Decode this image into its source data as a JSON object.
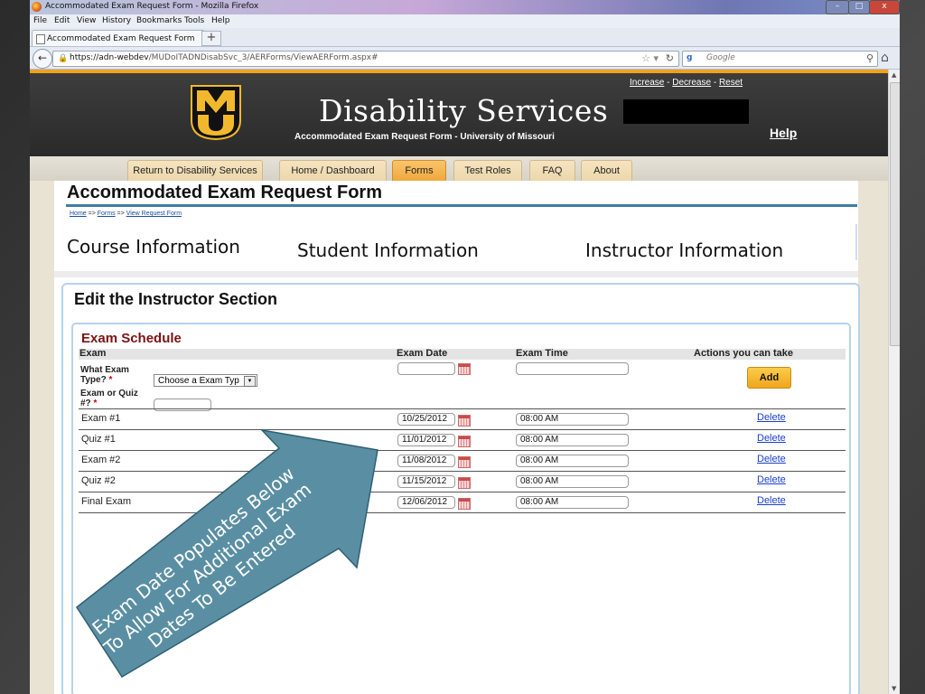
{
  "window": {
    "title": "Accommodated Exam Request Form - Mozilla Firefox",
    "minimize": "–",
    "maximize": "□",
    "close": "x"
  },
  "menu": [
    "File",
    "Edit",
    "View",
    "History",
    "Bookmarks",
    "Tools",
    "Help"
  ],
  "tab": {
    "label": "Accommodated Exam Request Form",
    "new_tab": "+"
  },
  "nav": {
    "url_host": "https://adn-webdev",
    "url_path": "/MUDoITADNDisabSvc_3/AERForms/ViewAERForm.aspx#",
    "search_engine": "g",
    "search_placeholder": "Google"
  },
  "header": {
    "logo_text": "MU",
    "title": "Disability Services",
    "subtitle": "Accommodated Exam Request Form - University of Missouri",
    "text_size": {
      "increase": "Increase",
      "decrease": "Decrease",
      "reset": "Reset",
      "sep": " - "
    },
    "help": "Help"
  },
  "navbar": [
    {
      "label": "Return to Disability Services"
    },
    {
      "label": "Home / Dashboard"
    },
    {
      "label": "Forms"
    },
    {
      "label": "Test Roles"
    },
    {
      "label": "FAQ"
    },
    {
      "label": "About"
    }
  ],
  "form": {
    "title": "Accommodated Exam Request Form",
    "breadcrumb": {
      "home": "Home",
      "forms": "Forms",
      "view": "View Request Form",
      "sep": " => "
    },
    "sections": [
      "Course Information",
      "Student Information",
      "Instructor Information"
    ],
    "edit_title": "Edit the Instructor Section"
  },
  "schedule": {
    "title": "Exam Schedule",
    "columns": {
      "exam": "Exam",
      "date": "Exam Date",
      "time": "Exam Time",
      "actions": "Actions you can take"
    },
    "type_label": "What Exam Type?",
    "number_label": "Exam or Quiz #?",
    "required_mark": "*",
    "type_select_value": "Choose a Exam Typ",
    "add_label": "Add",
    "delete_label": "Delete",
    "rows": [
      {
        "name": "Exam #1",
        "date": "10/25/2012",
        "time": "08:00 AM"
      },
      {
        "name": "Quiz #1",
        "date": "11/01/2012",
        "time": "08:00 AM"
      },
      {
        "name": "Exam #2",
        "date": "11/08/2012",
        "time": "08:00 AM"
      },
      {
        "name": "Quiz #2",
        "date": "11/15/2012",
        "time": "08:00 AM"
      },
      {
        "name": "Final Exam",
        "date": "12/06/2012",
        "time": "08:00 AM"
      }
    ]
  },
  "annotation": {
    "line1": "Exam Date Populates Below",
    "line2": "To Allow For Additional Exam",
    "line3": "Dates To Be Entered",
    "color": "#5a8fa3"
  },
  "colors": {
    "accent_orange": "#f0a21e",
    "mu_gold": "#f1b82d",
    "header_dark": "#2f2f2f",
    "link_blue": "#1a3fc9",
    "schedule_title": "#7a1313"
  }
}
